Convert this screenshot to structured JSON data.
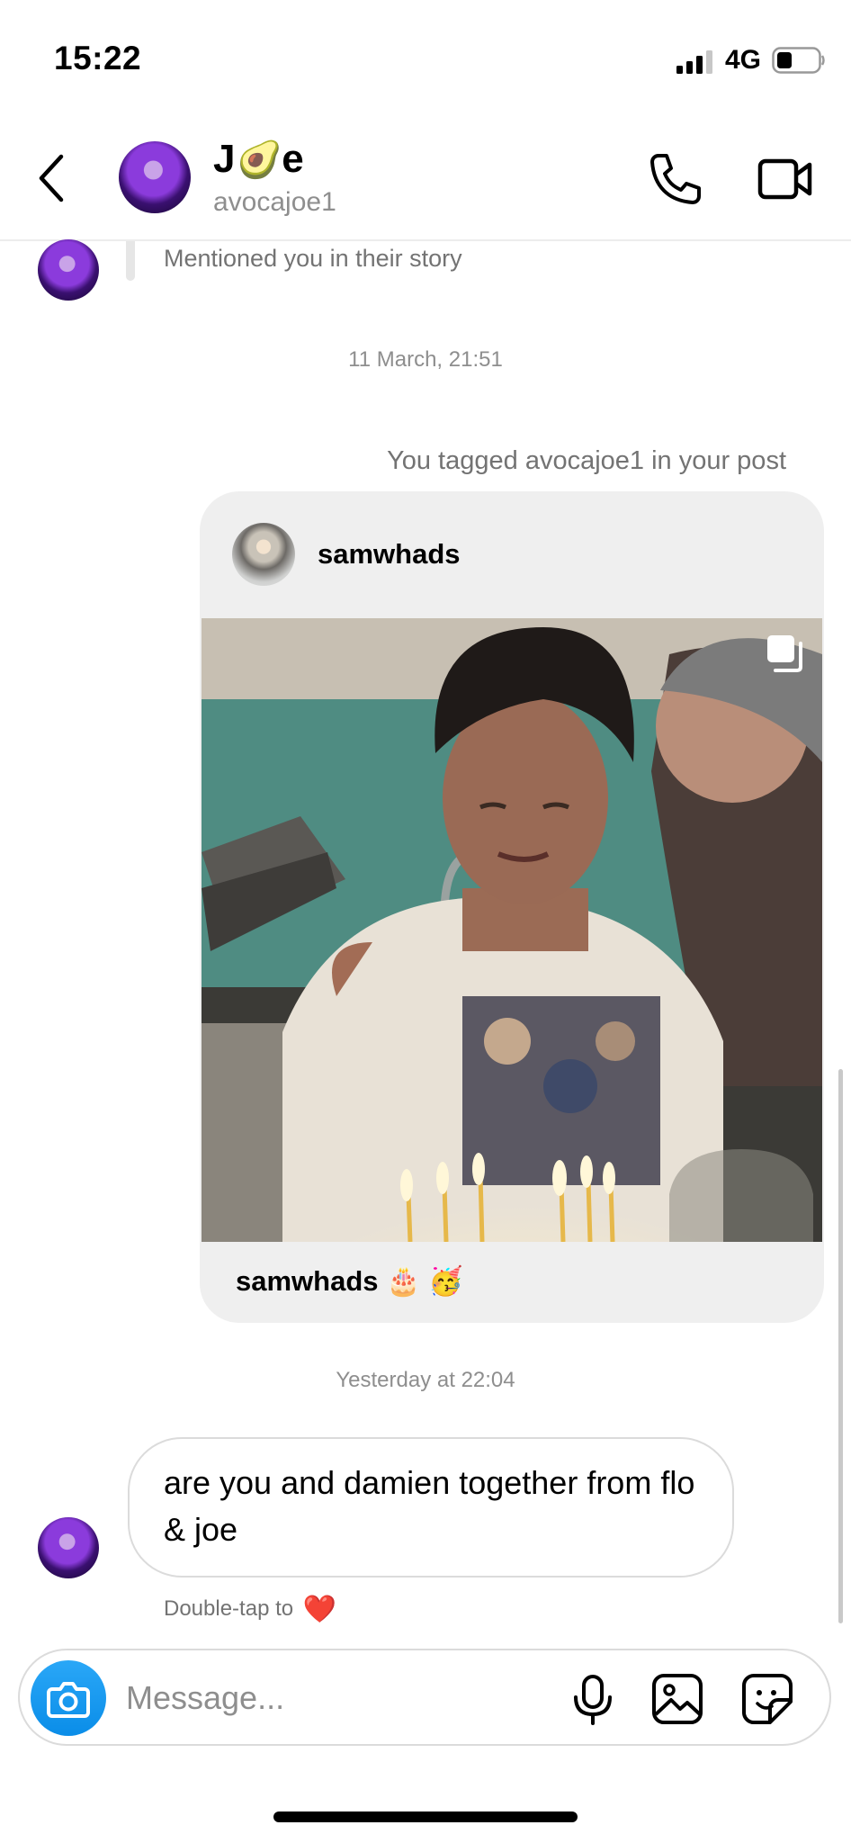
{
  "status_bar": {
    "time": "15:22",
    "network": "4G"
  },
  "header": {
    "contact_name_prefix": "J",
    "contact_name_emoji": "🥑",
    "contact_name_suffix": "e",
    "contact_handle": "avocajoe1",
    "icons": [
      "back-icon",
      "phone-icon",
      "video-camera-icon"
    ]
  },
  "conversation": {
    "story_mention": "Mentioned you in their story",
    "timestamp_1": "11 March, 21:51",
    "tag_note": "You tagged avocajoe1 in your post",
    "post": {
      "username": "samwhads",
      "caption_user": "samwhads",
      "caption_emojis": "🎂 🥳"
    },
    "timestamp_2": "Yesterday at 22:04",
    "message": "are you and damien together from flo & joe",
    "double_tap_hint": "Double-tap to",
    "double_tap_emoji": "❤️"
  },
  "composer": {
    "placeholder": "Message...",
    "icons": [
      "camera-icon",
      "microphone-icon",
      "gallery-icon",
      "sticker-icon"
    ]
  },
  "colors": {
    "accent": "#0a8de8",
    "heart": "#e0182d",
    "bubble_border": "#dbdbdb",
    "card_bg": "#efefef"
  }
}
